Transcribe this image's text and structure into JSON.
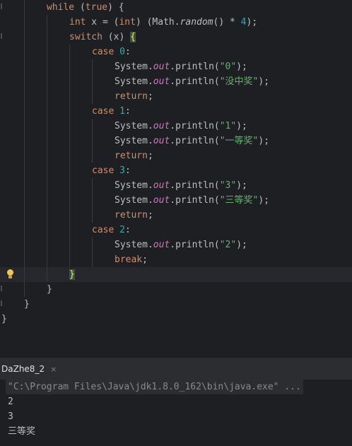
{
  "editor": {
    "lines": {
      "l0": {
        "kw1": "while",
        "p1": " (",
        "kw2": "true",
        "p2": ") {"
      },
      "l1": {
        "kw1": "int",
        "p1": " x = (",
        "kw2": "int",
        "p2": ") (Math.",
        "m": "random",
        "p3": "() * ",
        "n": "4",
        "p4": ");"
      },
      "l2": {
        "kw1": "switch",
        "p1": " (x) ",
        "brace": "{"
      },
      "l3": {
        "kw1": "case",
        "sp": " ",
        "n": "0",
        "p": ":"
      },
      "l4": {
        "a": "System.",
        "f": "out",
        "b": ".println(",
        "s": "\"0\"",
        "c": ");"
      },
      "l5": {
        "a": "System.",
        "f": "out",
        "b": ".println(",
        "s": "\"没中奖\"",
        "c": ");"
      },
      "l6": {
        "kw1": "return",
        "p": ";"
      },
      "l7": {
        "kw1": "case",
        "sp": " ",
        "n": "1",
        "p": ":"
      },
      "l8": {
        "a": "System.",
        "f": "out",
        "b": ".println(",
        "s": "\"1\"",
        "c": ");"
      },
      "l9": {
        "a": "System.",
        "f": "out",
        "b": ".println(",
        "s": "\"一等奖\"",
        "c": ");"
      },
      "l10": {
        "kw1": "return",
        "p": ";"
      },
      "l11": {
        "kw1": "case",
        "sp": " ",
        "n": "3",
        "p": ":"
      },
      "l12": {
        "a": "System.",
        "f": "out",
        "b": ".println(",
        "s": "\"3\"",
        "c": ");"
      },
      "l13": {
        "a": "System.",
        "f": "out",
        "b": ".println(",
        "s": "\"三等奖\"",
        "c": ");"
      },
      "l14": {
        "kw1": "return",
        "p": ";"
      },
      "l15": {
        "kw1": "case",
        "sp": " ",
        "n": "2",
        "p": ":"
      },
      "l16": {
        "a": "System.",
        "f": "out",
        "b": ".println(",
        "s": "\"2\"",
        "c": ");"
      },
      "l17": {
        "kw1": "break",
        "p": ";"
      },
      "l18": {
        "brace": "}"
      },
      "l19": {
        "t": "}"
      },
      "l20": {
        "t": "}"
      },
      "l21": {
        "t": "}"
      }
    },
    "intention_icon": "lightbulb-icon"
  },
  "console": {
    "tab_label": "DaZhe8_2",
    "tab_close": "×",
    "command": "\"C:\\Program Files\\Java\\jdk1.8.0_162\\bin\\java.exe\" ...",
    "output": [
      "2",
      "3",
      "三等奖"
    ]
  },
  "colors": {
    "background": "#1e1f22",
    "keyword": "#cf8e6d",
    "number": "#2aacb8",
    "string": "#6aab73",
    "field": "#c77dbb",
    "text": "#bcbec4",
    "matched_brace": "#ffef28"
  }
}
